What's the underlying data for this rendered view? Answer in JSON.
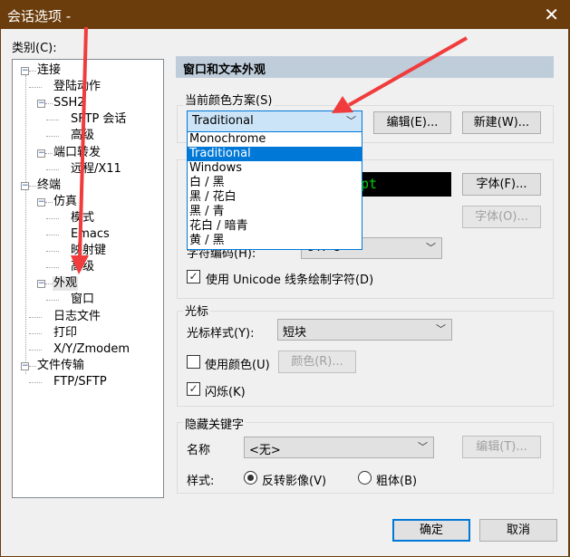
{
  "window": {
    "title": "会话选项 -",
    "close_icon": "close-icon"
  },
  "category_label": "类别(C):",
  "tree": [
    {
      "label": "连接",
      "level": 0,
      "expander": true
    },
    {
      "label": "登陆动作",
      "level": 1
    },
    {
      "label": "SSH2",
      "level": 1,
      "expander": true
    },
    {
      "label": "SFTP 会话",
      "level": 2
    },
    {
      "label": "高级",
      "level": 2
    },
    {
      "label": "端口转发",
      "level": 1,
      "expander": true
    },
    {
      "label": "远程/X11",
      "level": 2
    },
    {
      "label": "终端",
      "level": 0,
      "expander": true
    },
    {
      "label": "仿真",
      "level": 1,
      "expander": true
    },
    {
      "label": "模式",
      "level": 2
    },
    {
      "label": "Emacs",
      "level": 2
    },
    {
      "label": "映射键",
      "level": 2
    },
    {
      "label": "高级",
      "level": 2
    },
    {
      "label": "外观",
      "level": 1,
      "expander": true,
      "selected": true
    },
    {
      "label": "窗口",
      "level": 2
    },
    {
      "label": "日志文件",
      "level": 1
    },
    {
      "label": "打印",
      "level": 1
    },
    {
      "label": "X/Y/Zmodem",
      "level": 1
    },
    {
      "label": "文件传输",
      "level": 0,
      "expander": true
    },
    {
      "label": "FTP/SFTP",
      "level": 1
    }
  ],
  "panel": {
    "header": "窗口和文本外观",
    "scheme": {
      "label": "当前颜色方案(S)",
      "value": "Traditional",
      "edit": "编辑(E)...",
      "new": "新建(W)...",
      "options": [
        "Monochrome",
        "Traditional",
        "Windows",
        "白 / 黑",
        "黑 / 花白",
        "黑 / 青",
        "花白 / 暗青",
        "黄 / 黑"
      ],
      "highlighted": 1
    },
    "font": {
      "preview": "pt",
      "font_btn": "字体(F)...",
      "font2_btn": "字体(O)...",
      "encoding_label": "字符编码(H):",
      "encoding_value": "UTF-8",
      "unicode_label": "使用 Unicode 线条绘制字符(D)",
      "unicode_checked": true
    },
    "cursor": {
      "group": "光标",
      "style_label": "光标样式(Y):",
      "style_value": "短块",
      "use_color_label": "使用颜色(U)",
      "use_color_checked": false,
      "color_btn": "颜色(R)...",
      "blink_label": "闪烁(K)",
      "blink_checked": true
    },
    "keyword": {
      "group": "隐藏关键字",
      "name_label": "名称",
      "name_value": "<无>",
      "edit_btn": "编辑(T)...",
      "style_label": "样式:",
      "opt1": "反转影像(V)",
      "opt2": "粗体(B)",
      "selected": "opt1"
    }
  },
  "buttons": {
    "ok": "确定",
    "cancel": "取消"
  },
  "colors": {
    "titlebar": "#6b3d0c",
    "header": "#bfcddb",
    "highlight": "#0078d7",
    "annotation_arrow": "#f03c3c"
  }
}
